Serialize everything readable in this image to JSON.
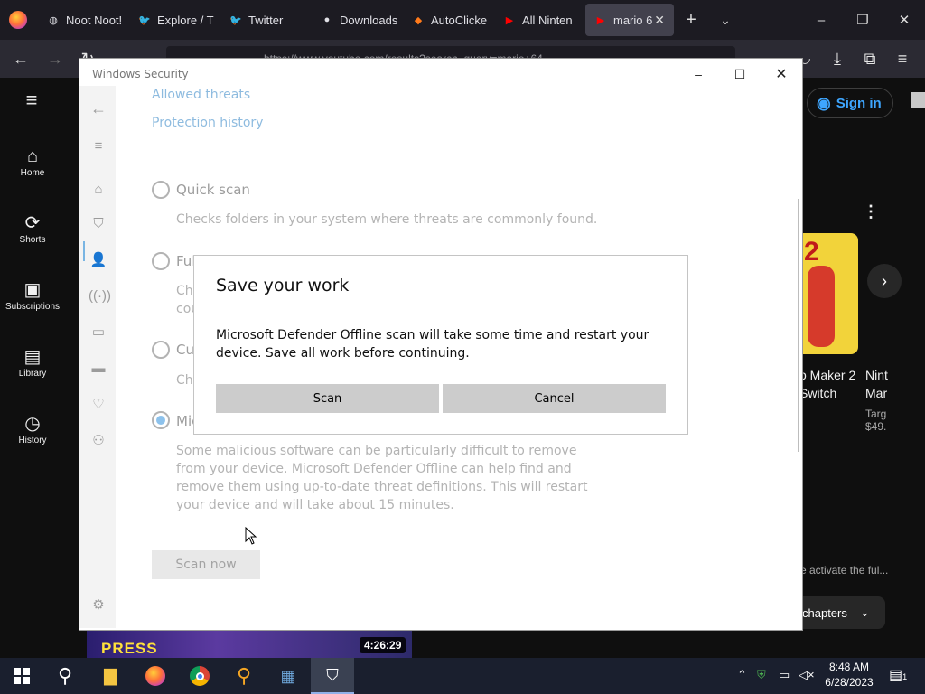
{
  "browser": {
    "tabs": [
      {
        "label": "Noot Noot!",
        "icon": "generic-tab-icon"
      },
      {
        "label": "Explore / T",
        "icon": "twitter-icon"
      },
      {
        "label": "Twitter",
        "icon": "twitter-icon"
      },
      {
        "label": "Downloads",
        "icon": "downloads-icon"
      },
      {
        "label": "AutoClicke",
        "icon": "autoclicker-icon"
      },
      {
        "label": "All Ninten",
        "icon": "youtube-icon"
      },
      {
        "label": "mario 6",
        "icon": "youtube-icon",
        "active": true
      }
    ],
    "url": "https://www.youtube.com/results?search_query=mario+64"
  },
  "youtube": {
    "sidebar": [
      {
        "label": "Home",
        "icon": "home-icon"
      },
      {
        "label": "Shorts",
        "icon": "shorts-icon"
      },
      {
        "label": "Subscriptions",
        "icon": "subscriptions-icon"
      },
      {
        "label": "Library",
        "icon": "library-icon"
      },
      {
        "label": "History",
        "icon": "history-icon"
      }
    ],
    "sign_in": "Sign in",
    "card1_title_a": "o Maker 2",
    "card1_title_b": "Switch",
    "card2_title_a": "Nint",
    "card2_title_b": "Mar",
    "card2_sub_a": "Targ",
    "card2_sub_b": "$49.",
    "activate_text": "e activate the ful...",
    "chapters": "chapters",
    "duration": "4:26:29",
    "thumb_number": "2"
  },
  "security_window": {
    "title": "Windows Security",
    "links": [
      "Allowed threats",
      "Protection history"
    ],
    "options": [
      {
        "label": "Quick scan",
        "desc": "Checks folders in your system where threats are commonly found."
      },
      {
        "label": "Ful",
        "desc_a": "Che",
        "desc_b": "cou"
      },
      {
        "label": "Cus",
        "desc_a": "Che"
      },
      {
        "label": "Mic",
        "selected": true
      }
    ],
    "offline_desc": "Some malicious software can be particularly difficult to remove from your device. Microsoft Defender Offline can help find and remove them using up-to-date threat definitions. This will restart your device and will take about 15 minutes.",
    "scan_now": "Scan now"
  },
  "dialog": {
    "title": "Save your work",
    "body": "Microsoft Defender Offline scan will take some time and restart your device. Save all work before continuing.",
    "scan_label": "Scan",
    "cancel_label": "Cancel"
  },
  "taskbar": {
    "time": "8:48 AM",
    "date": "6/28/2023",
    "notification_count": "1"
  }
}
